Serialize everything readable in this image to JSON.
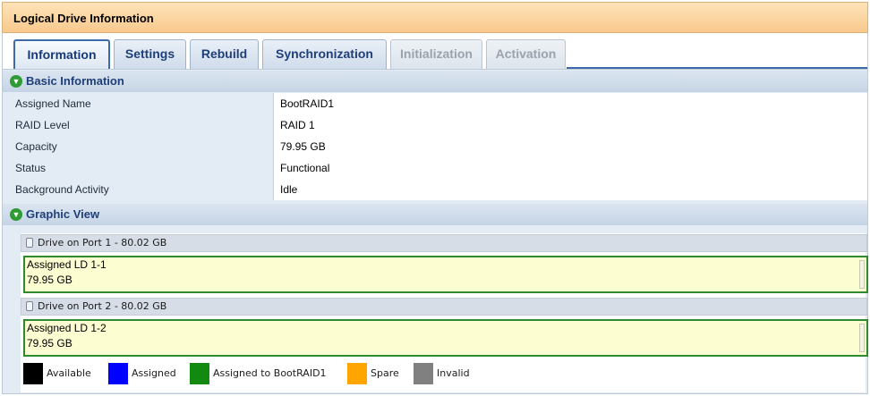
{
  "window": {
    "title": "Logical Drive Information"
  },
  "tabs": [
    {
      "label": "Information",
      "state": "active"
    },
    {
      "label": "Settings",
      "state": "normal"
    },
    {
      "label": "Rebuild",
      "state": "normal"
    },
    {
      "label": "Synchronization",
      "state": "normal"
    },
    {
      "label": "Initialization",
      "state": "disabled"
    },
    {
      "label": "Activation",
      "state": "disabled"
    }
  ],
  "basic_info": {
    "header": "Basic Information",
    "rows": [
      {
        "label": "Assigned Name",
        "value": "BootRAID1"
      },
      {
        "label": "RAID Level",
        "value": "RAID 1"
      },
      {
        "label": "Capacity",
        "value": "79.95 GB"
      },
      {
        "label": "Status",
        "value": "Functional"
      },
      {
        "label": "Background Activity",
        "value": "Idle"
      }
    ]
  },
  "graphic_view": {
    "header": "Graphic View",
    "drives": [
      {
        "header": "Drive on Port 1 - 80.02 GB",
        "ld_name": "Assigned LD 1-1",
        "ld_size": "79.95 GB"
      },
      {
        "header": "Drive on Port 2 - 80.02 GB",
        "ld_name": "Assigned LD 1-2",
        "ld_size": "79.95 GB"
      }
    ],
    "legend": [
      {
        "label": "Available",
        "color": "#000000"
      },
      {
        "label": "Assigned",
        "color": "#0000ff"
      },
      {
        "label": "Assigned to BootRAID1",
        "color": "#128a12"
      },
      {
        "label": "Spare",
        "color": "#ffa500"
      },
      {
        "label": "Invalid",
        "color": "#808080"
      }
    ]
  },
  "icons": {
    "section_toggle": "chevron-down-icon",
    "drive": "disk-icon"
  }
}
